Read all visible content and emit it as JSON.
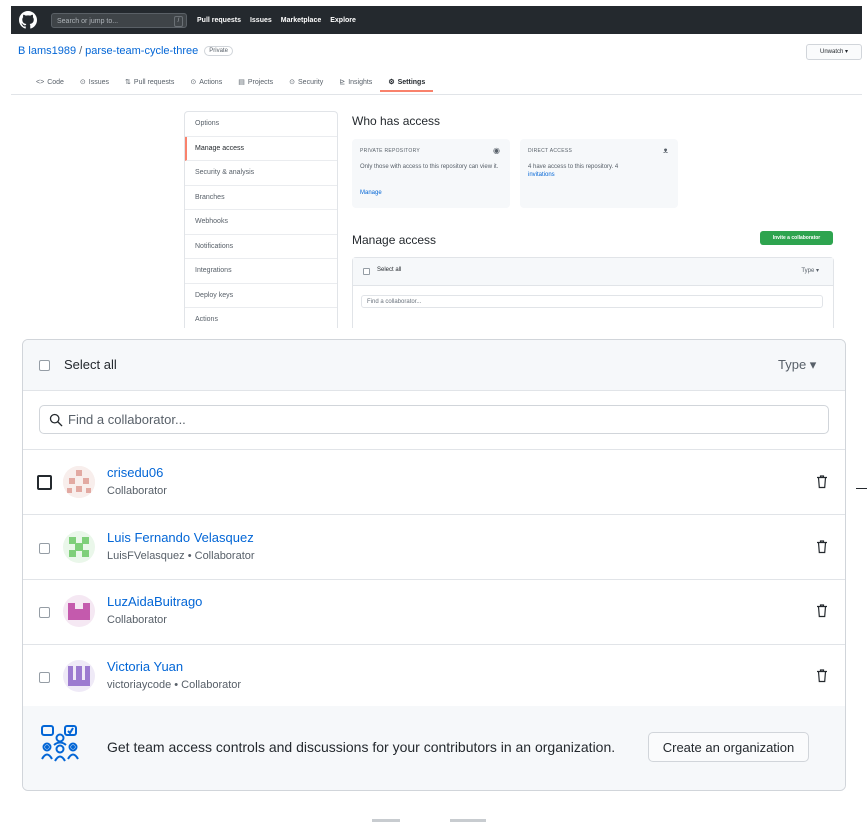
{
  "header": {
    "search_placeholder": "Search or jump to...",
    "slash_key": "/",
    "nav": [
      "Pull requests",
      "Issues",
      "Marketplace",
      "Explore"
    ]
  },
  "repo": {
    "owner": "B lams1989",
    "separator": "/",
    "name": "parse-team-cycle-three",
    "visibility": "Private",
    "watch_label": "Unwatch ▾"
  },
  "tabs": [
    {
      "label": "Code",
      "icon": "code-icon"
    },
    {
      "label": "Issues",
      "icon": "issue-icon"
    },
    {
      "label": "Pull requests",
      "icon": "pull-request-icon"
    },
    {
      "label": "Actions",
      "icon": "play-icon"
    },
    {
      "label": "Projects",
      "icon": "project-icon"
    },
    {
      "label": "Security",
      "icon": "shield-icon"
    },
    {
      "label": "Insights",
      "icon": "graph-icon"
    },
    {
      "label": "Settings",
      "icon": "gear-icon",
      "active": true
    }
  ],
  "sidebar": {
    "items": [
      "Options",
      "Manage access",
      "Security & analysis",
      "Branches",
      "Webhooks",
      "Notifications",
      "Integrations",
      "Deploy keys",
      "Actions"
    ],
    "active_index": 1
  },
  "who_has_access": {
    "title": "Who has access",
    "private_card": {
      "title": "PRIVATE REPOSITORY",
      "text": "Only those with access to this repository can view it.",
      "link": "Manage"
    },
    "direct_card": {
      "title": "DIRECT ACCESS",
      "text": "4 have access to this repository. 4",
      "link": "invitations"
    }
  },
  "manage_access": {
    "title": "Manage access",
    "invite_label": "Invite a collaborator",
    "select_all": "Select all",
    "type_label": "Type ▾",
    "search_placeholder": "Find a collaborator..."
  },
  "collaborators": [
    {
      "name": "crisedu06",
      "subtitle": "Collaborator"
    },
    {
      "name": "Luis Fernando Velasquez",
      "subtitle": "LuisFVelasquez • Collaborator"
    },
    {
      "name": "LuzAidaBuitrago",
      "subtitle": "Collaborator"
    },
    {
      "name": "Victoria Yuan",
      "subtitle": "victoriaycode • Collaborator"
    }
  ],
  "footer": {
    "promo_text": "Get team access controls and discussions for your contributors in an organization.",
    "create_org_label": "Create an organization"
  },
  "colors": {
    "accent_blue": "#0366d6",
    "green_button": "#2ea44f",
    "header_dark": "#24292e",
    "active_tab_underline": "#f9826c"
  }
}
